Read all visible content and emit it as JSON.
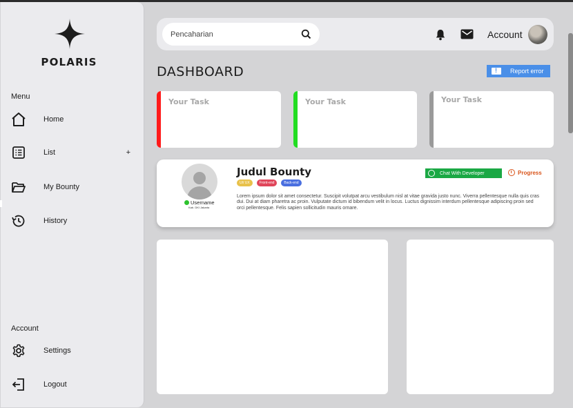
{
  "brand": {
    "name": "POLARIS"
  },
  "sidebar": {
    "menu_label": "Menu",
    "account_label": "Account",
    "items": [
      {
        "label": "Home",
        "icon": "home-icon"
      },
      {
        "label": "List",
        "icon": "list-icon",
        "extra": "+"
      },
      {
        "label": "My Bounty",
        "icon": "folder-icon"
      },
      {
        "label": "History",
        "icon": "history-icon"
      }
    ],
    "account_items": [
      {
        "label": "Settings",
        "icon": "gear-icon"
      },
      {
        "label": "Logout",
        "icon": "logout-icon"
      }
    ]
  },
  "header": {
    "search_placeholder": "Pencaharian",
    "account": "Account"
  },
  "page": {
    "title": "DASHBOARD",
    "report_label": "Report error"
  },
  "tasks": [
    {
      "title": "Your Task",
      "accent": "#ff1a1a"
    },
    {
      "title": "Your Task",
      "accent": "#22dd22"
    },
    {
      "title": "Your Task",
      "accent": "#9a9a9a"
    }
  ],
  "bounty": {
    "username": "Username",
    "location": "Kab. DKI Jakarta",
    "title": "Judul Bounty",
    "tags": [
      {
        "label": "UI/ UX",
        "color": "#e8c14a"
      },
      {
        "label": "Front-end",
        "color": "#e0455a"
      },
      {
        "label": "Back-end",
        "color": "#4a6fe0"
      }
    ],
    "description": "Lorem ipsum dolor sit amet consectetur. Suscipit volutpat arcu vestibulum nisl at vitae gravida justo nunc. Viverra pellentesque nulla quis cras dui. Dui at diam pharetra ac proin. Vulputate dictum id bibendum velit in locus. Luctus dignissim interdum pellentesque adipiscing proin sed orci pellentesque. Felis sapien sollicitudin mauris ornare.",
    "chat_label": "Chat With Developer",
    "status": "Progress"
  },
  "colors": {
    "report": "#4a8fe8",
    "chat": "#1aa844",
    "status": "#d9541a"
  }
}
